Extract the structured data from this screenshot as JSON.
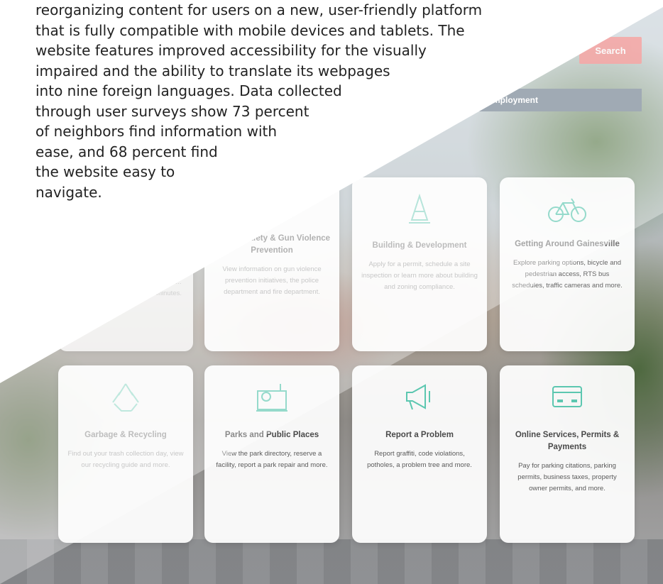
{
  "article": {
    "lines": [
      "reorganizing content for users on a new, user-friendly platform",
      "that is fully compatible with mobile devices and tablets. The",
      "website features improved accessibility for the visually",
      "impaired and the ability to translate its webpages",
      "into nine foreign languages. Data collected",
      "through user surveys show 73 percent",
      "of neighbors find information with",
      "ease, and 68 percent find",
      "the website easy to",
      "navigate."
    ]
  },
  "header": {
    "search_label": "Search",
    "employment_label": "Employment"
  },
  "cards_top": [
    {
      "title": "",
      "desc": "…gs …eeting … agendas and …minutes."
    },
    {
      "title": "…ublic Safety & Gun Violence Prevention",
      "desc": "View information on gun violence prevention initiatives, the police department and fire department."
    },
    {
      "title": "Building & Development",
      "desc": "Apply for a permit, schedule a site inspection or learn more about building and zoning compliance."
    },
    {
      "title": "Getting Around Gainesville",
      "desc": "Explore parking options, bicycle and pedestrian access, RTS bus schedules, traffic cameras and more."
    }
  ],
  "cards_bottom": [
    {
      "title": "Garbage & Recycling",
      "desc": "Find out your trash collection day, view our recycling guide and more."
    },
    {
      "title": "Parks and Public Places",
      "desc": "View the park directory, reserve a facility, report a park repair and more."
    },
    {
      "title": "Report a Problem",
      "desc": "Report graffiti, code violations, potholes, a problem tree and more."
    },
    {
      "title": "Online Services, Permits & Payments",
      "desc": "Pay for parking citations, parking permits, business taxes, property owner permits, and more."
    }
  ],
  "icons": {
    "color": "#5cc7b0"
  }
}
